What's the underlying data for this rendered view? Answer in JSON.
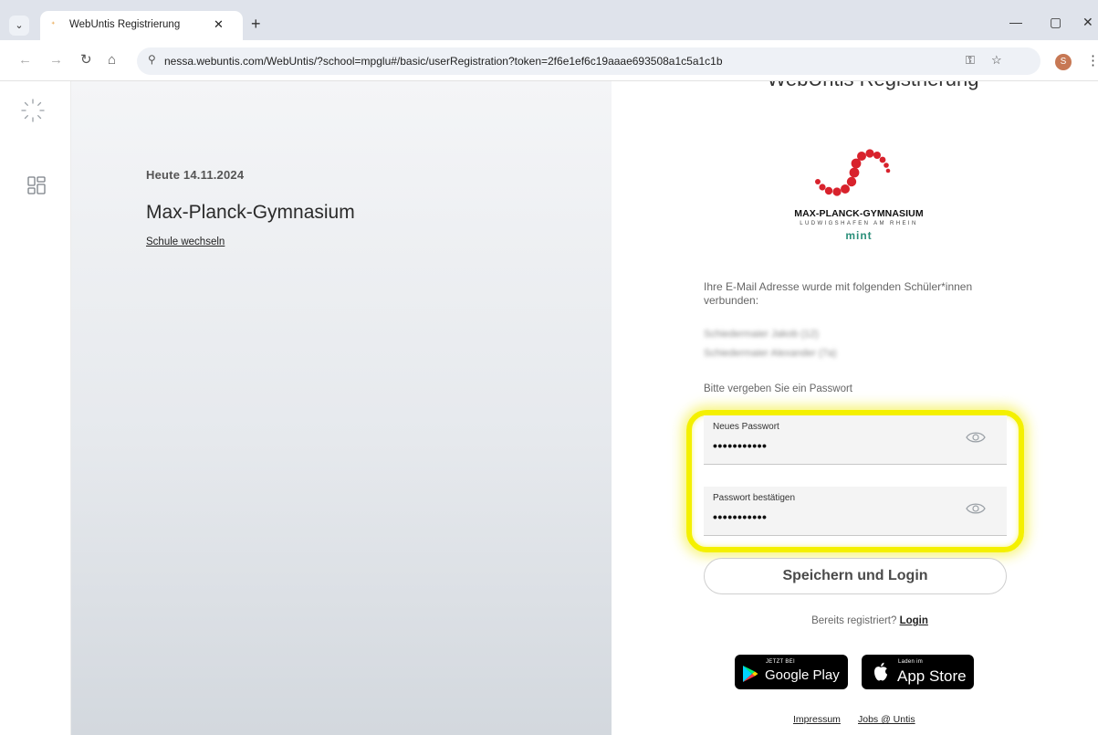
{
  "browser": {
    "tab_title": "WebUntis Registrierung",
    "tab_close": "✕",
    "new_tab": "+",
    "url": "nessa.webuntis.com/WebUntis/?school=mpglu#/basic/userRegistration?token=2f6e1ef6c19aaae693508a1c5a1c1b",
    "profile_initial": "S"
  },
  "hero": {
    "today": "Heute 14.11.2024",
    "school_name": "Max-Planck-Gymnasium",
    "switch_school": "Schule wechseln"
  },
  "panel": {
    "heading": "WebUntis Registrierung",
    "logo_name": "MAX-PLANCK-GYMNASIUM",
    "logo_sub": "LUDWIGSHAFEN AM RHEIN",
    "logo_mint": "mint",
    "info_text": "Ihre E-Mail Adresse wurde mit folgenden Schüler*innen verbunden:",
    "students": [
      "Schiedermaier Jakob (12)",
      "Schiedermaier Alexander (7a)"
    ],
    "password_prompt": "Bitte vergeben Sie ein Passwort",
    "new_password": {
      "label": "Neues Passwort",
      "value": "•••••••••••"
    },
    "confirm_password": {
      "label": "Passwort bestätigen",
      "value": "•••••••••••"
    },
    "submit_label": "Speichern und Login",
    "already_registered": "Bereits registriert?",
    "login_link": "Login",
    "google_play": {
      "small": "JETZT BEI",
      "big": "Google Play"
    },
    "app_store": {
      "small": "Laden im",
      "big": "App Store"
    },
    "footer": {
      "impressum": "Impressum",
      "jobs": "Jobs @ Untis"
    }
  },
  "colors": {
    "highlight": "#f4f000",
    "logo_red": "#d8222c",
    "mint": "#2a8f7a"
  }
}
